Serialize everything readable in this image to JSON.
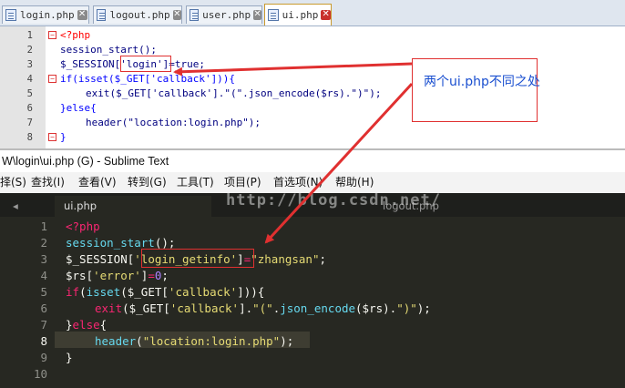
{
  "top_editor": {
    "tabs": [
      {
        "label": "login.php",
        "active": false
      },
      {
        "label": "logout.php",
        "active": false
      },
      {
        "label": "user.php",
        "active": false
      },
      {
        "label": "ui.php",
        "active": true
      }
    ],
    "line_numbers": [
      "1",
      "2",
      "3",
      "4",
      "5",
      "6",
      "7",
      "8"
    ],
    "lines": [
      [
        "<?php"
      ],
      [
        "session_start();"
      ],
      [
        "$_SESSION['login']=true;"
      ],
      [
        "if(isset($_GET['callback'])){"
      ],
      [
        "exit($_GET['callback'].\"(\".json_encode($rs).\")\");"
      ],
      [
        "}else{"
      ],
      [
        "header(\"location:login.php\");"
      ],
      [
        "}"
      ]
    ]
  },
  "window_title": "W\\login\\ui.php (G) - Sublime Text",
  "menu": [
    "择(S)",
    "查找(I)",
    "查看(V)",
    "转到(G)",
    "工具(T)",
    "项目(P)",
    "首选项(N)",
    "帮助(H)"
  ],
  "sublime_tabs": [
    "ui.php",
    "logout.php"
  ],
  "watermark": "http://blog.csdn.net/",
  "sublime_line_numbers": [
    "1",
    "2",
    "3",
    "4",
    "5",
    "6",
    "7",
    "8",
    "9",
    "10"
  ],
  "sublime_lines": {
    "l1": "<?php",
    "l2a": "session_start",
    "l2b": "();",
    "l3a": "$_SESSION[",
    "l3b": "'login_getinfo'",
    "l3c": "]",
    "l3d": "=",
    "l3e": "\"zhangsan\"",
    "l3f": ";",
    "l4a": "$rs[",
    "l4b": "'error'",
    "l4c": "]",
    "l4d": "=",
    "l4e": "0",
    "l4f": ";",
    "l5a": "if",
    "l5b": "(",
    "l5c": "isset",
    "l5d": "($_GET[",
    "l5e": "'callback'",
    "l5f": "])){",
    "l6a": "exit",
    "l6b": "($_GET[",
    "l6c": "'callback'",
    "l6d": "].",
    "l6e": "\"(\"",
    "l6f": ".",
    "l6g": "json_encode",
    "l6h": "($rs).",
    "l6i": "\")\"",
    "l6j": ");",
    "l7a": "}",
    "l7b": "else",
    "l7c": "{",
    "l8a": "header",
    "l8b": "(",
    "l8c": "\"location:login.php\"",
    "l8d": ");",
    "l9": "}"
  },
  "annotation": "两个ui.php不同之处",
  "colors": {
    "annotation_border": "#e03030",
    "annotation_text": "#1a4fd0",
    "sublime_bg": "#272822"
  }
}
